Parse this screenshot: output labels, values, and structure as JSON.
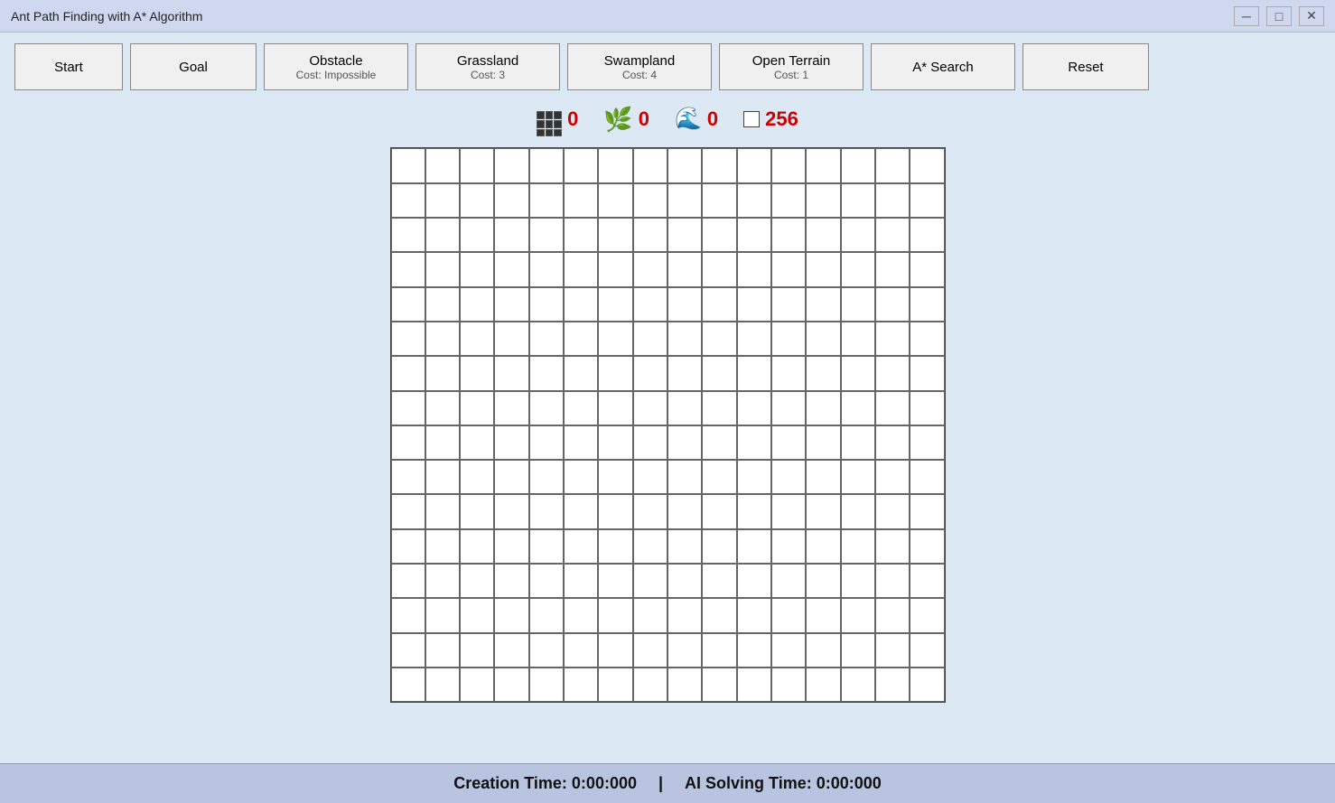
{
  "titleBar": {
    "title": "Ant Path Finding with A* Algorithm",
    "minimize": "─",
    "maximize": "□",
    "close": "✕"
  },
  "toolbar": {
    "start": {
      "label": "Start",
      "sublabel": ""
    },
    "goal": {
      "label": "Goal",
      "sublabel": ""
    },
    "obstacle": {
      "label": "Obstacle",
      "sublabel": "Cost: Impossible"
    },
    "grassland": {
      "label": "Grassland",
      "sublabel": "Cost: 3"
    },
    "swampland": {
      "label": "Swampland",
      "sublabel": "Cost: 4"
    },
    "openTerrain": {
      "label": "Open Terrain",
      "sublabel": "Cost: 1"
    },
    "astar": {
      "label": "A* Search",
      "sublabel": ""
    },
    "reset": {
      "label": "Reset",
      "sublabel": ""
    }
  },
  "stats": {
    "obstacleCount": "0",
    "grasslandCount": "0",
    "swamplandCount": "0",
    "totalCount": "256"
  },
  "grid": {
    "rows": 16,
    "cols": 16
  },
  "statusBar": {
    "creationLabel": "Creation Time:",
    "creationTime": "0:00:000",
    "separator": "|",
    "aiLabel": "AI Solving Time:",
    "aiTime": "0:00:000"
  }
}
